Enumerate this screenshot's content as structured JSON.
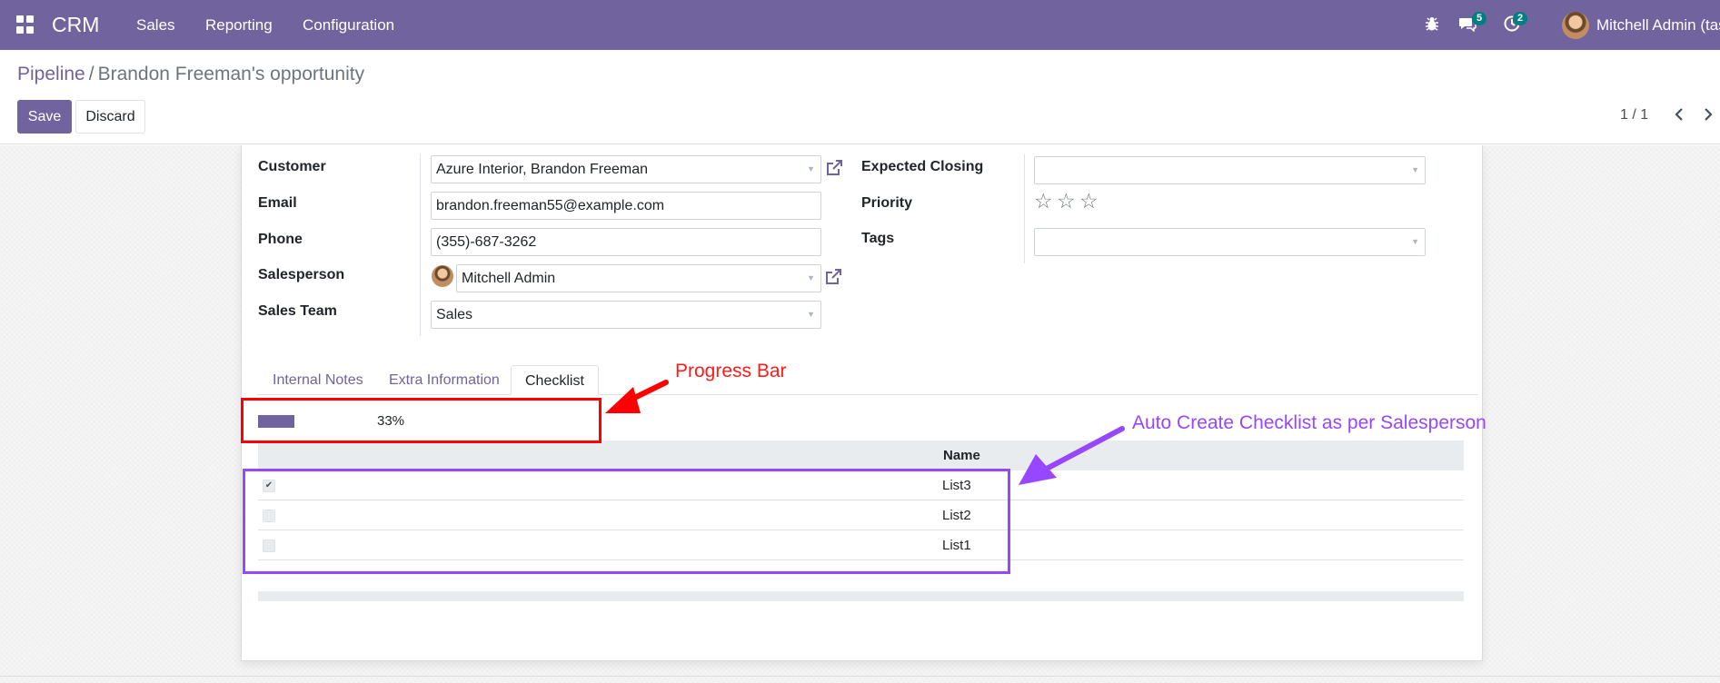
{
  "navbar": {
    "brand": "CRM",
    "menu": [
      "Sales",
      "Reporting",
      "Configuration"
    ],
    "messages_count": "5",
    "activities_count": "2",
    "user": "Mitchell Admin (task"
  },
  "breadcrumb": {
    "parent": "Pipeline",
    "separator": "/",
    "current": "Brandon Freeman's opportunity"
  },
  "actions": {
    "save": "Save",
    "discard": "Discard"
  },
  "pager": {
    "value": "1 / 1"
  },
  "form": {
    "customer_label": "Customer",
    "customer_value": "Azure Interior, Brandon Freeman",
    "email_label": "Email",
    "email_value": "brandon.freeman55@example.com",
    "phone_label": "Phone",
    "phone_value": "(355)-687-3262",
    "salesperson_label": "Salesperson",
    "salesperson_value": "Mitchell Admin",
    "sales_team_label": "Sales Team",
    "sales_team_value": "Sales",
    "expected_closing_label": "Expected Closing",
    "expected_closing_value": "",
    "priority_label": "Priority",
    "priority_stars_filled": 0,
    "priority_stars_total": 3,
    "tags_label": "Tags",
    "tags_value": ""
  },
  "tabs": [
    {
      "label": "Internal Notes",
      "active": false
    },
    {
      "label": "Extra Information",
      "active": false
    },
    {
      "label": "Checklist",
      "active": true
    }
  ],
  "checklist": {
    "progress_percent": 33,
    "progress_label": "33%",
    "column_name": "Name",
    "rows": [
      {
        "name": "List3",
        "checked": true
      },
      {
        "name": "List2",
        "checked": false
      },
      {
        "name": "List1",
        "checked": false
      }
    ]
  },
  "annotations": {
    "progress_bar": "Progress Bar",
    "auto_create": "Auto Create Checklist as per Salesperson",
    "red_color": "#ff0000",
    "purple_color": "#9747ff"
  },
  "colors": {
    "brand": "#71639e",
    "badge": "#017e84"
  },
  "icons": [
    "apps-grid-icon",
    "bug-icon",
    "chat-icon",
    "clock-icon",
    "external-link-icon",
    "star-icon",
    "chevron-left-icon",
    "chevron-right-icon",
    "checkmark-icon"
  ]
}
